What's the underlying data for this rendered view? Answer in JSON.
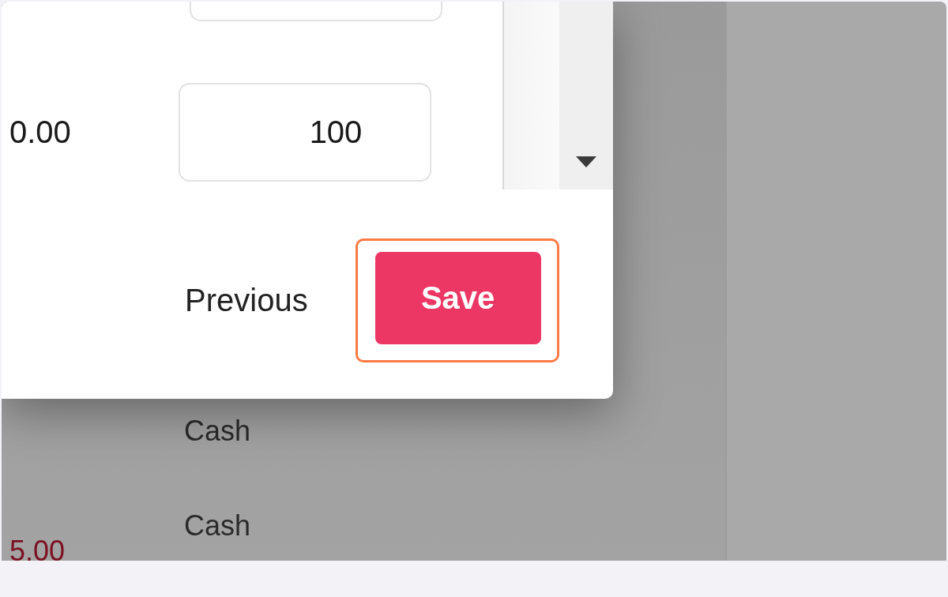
{
  "dialog": {
    "rows": [
      {
        "amount": "0.00",
        "value": "100"
      }
    ],
    "buttons": [
      {
        "label": "Previous",
        "kind": "text"
      },
      {
        "label": "Save",
        "kind": "primary",
        "highlighted": true
      }
    ]
  },
  "background_lines": [
    {
      "kind": "method",
      "text": "Cash"
    },
    {
      "kind": "method",
      "text": "Cash"
    },
    {
      "kind": "amount",
      "text": "5.00"
    }
  ]
}
